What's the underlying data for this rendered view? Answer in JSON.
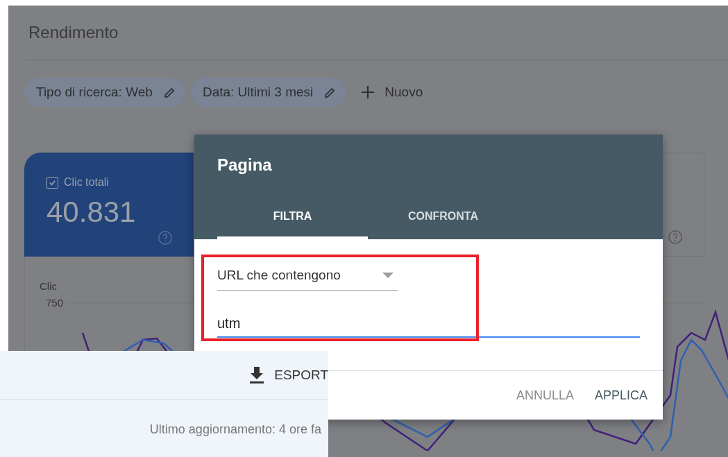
{
  "page": {
    "title": "Rendimento"
  },
  "filters": [
    {
      "label": "Tipo di ricerca: Web"
    },
    {
      "label": "Data: Ultimi 3 mesi"
    }
  ],
  "new_filter": {
    "label": "Nuovo"
  },
  "metric_card": {
    "label": "Clic totali",
    "value": "40.831",
    "checked": true
  },
  "chart": {
    "ylabel": "Clic",
    "tick": "750"
  },
  "dialog": {
    "title": "Pagina",
    "tabs": [
      {
        "label": "FILTRA",
        "selected": true
      },
      {
        "label": "CONFRONTA",
        "selected": false
      }
    ],
    "condition": "URL che contengono",
    "value": "utm",
    "buttons": [
      {
        "label": "ANNULLA",
        "kind": "secondary"
      },
      {
        "label": "APPLICA",
        "kind": "primary"
      }
    ]
  },
  "inset": {
    "export": "ESPORT",
    "updated": "Ultimo aggiornamento: 4 ore fa"
  }
}
